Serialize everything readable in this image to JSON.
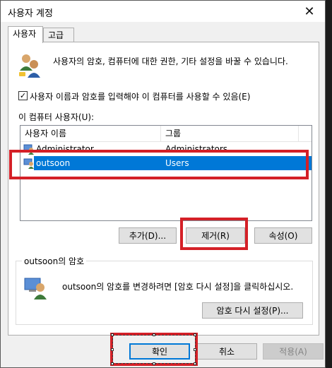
{
  "window": {
    "title": "사용자 계정"
  },
  "tabs": [
    {
      "label": "사용자"
    },
    {
      "label": "고급"
    }
  ],
  "users_tab": {
    "intro": "사용자의 암호, 컴퓨터에 대한 권한, 기타 설정을 바꿀 수 있습니다.",
    "checkbox_label": "사용자 이름과 암호를 입력해야 이 컴퓨터를 사용할 수 있음(E)",
    "checkbox_mark": "✓",
    "list_label": "이 컴퓨터 사용자(U):",
    "columns": [
      "사용자 이름",
      "그룹"
    ],
    "rows": [
      {
        "name": "Administrator",
        "group": "Administrators"
      },
      {
        "name": "outsoon",
        "group": "Users"
      }
    ],
    "buttons": {
      "add": "추가(D)...",
      "remove": "제거(R)",
      "properties": "속성(O)"
    },
    "password_group": {
      "title": "outsoon의 암호",
      "text": "outsoon의 암호를 변경하려면 [암호 다시 설정]을 클릭하십시오.",
      "reset_button": "암호 다시 설정(P)..."
    }
  },
  "footer": {
    "ok": "확인",
    "cancel": "취소",
    "apply": "적용(A)"
  },
  "colors": {
    "selection": "#0078d7",
    "highlight_box": "#d42027"
  },
  "icons": {
    "close": "close-icon",
    "users": "users-icon",
    "user": "user-icon",
    "password_user": "password-user-icon"
  }
}
